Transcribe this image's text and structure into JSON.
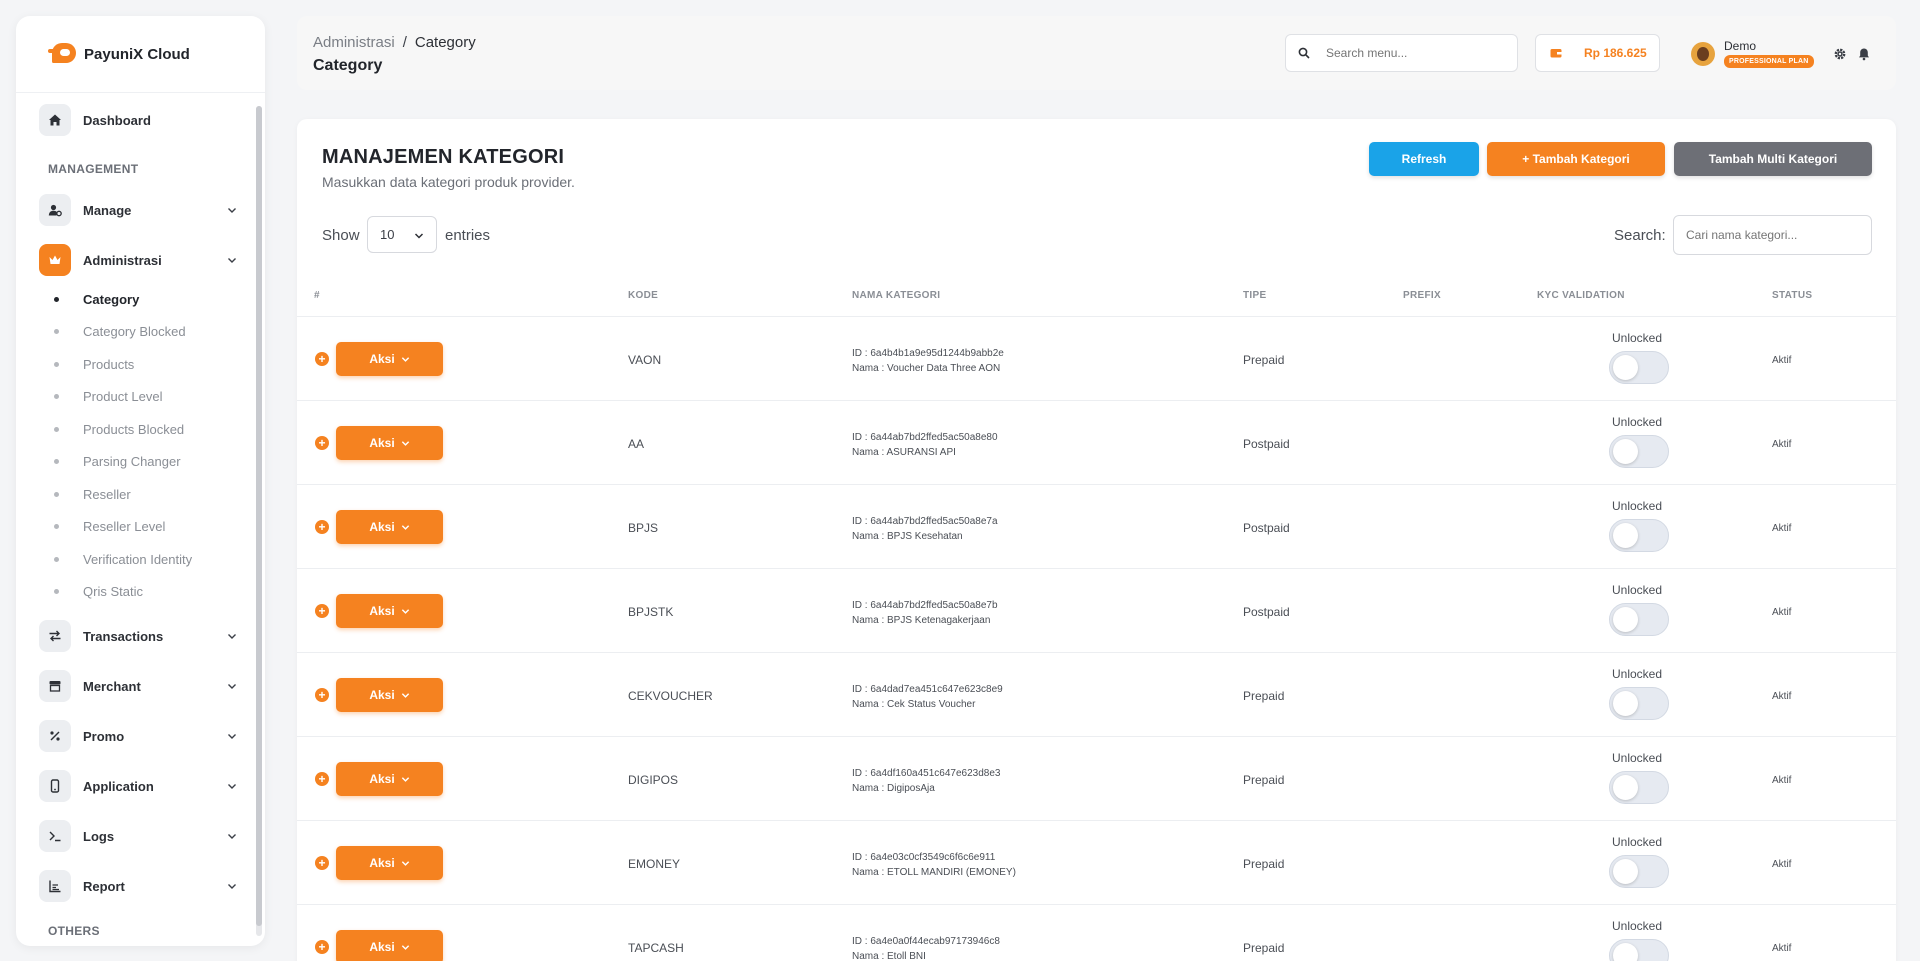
{
  "brand": {
    "name": "PayuniX Cloud"
  },
  "sidebar": {
    "dashboard_label": "Dashboard",
    "management_label": "MANAGEMENT",
    "manage_label": "Manage",
    "administrasi_label": "Administrasi",
    "sub_items": [
      "Category",
      "Category Blocked",
      "Products",
      "Product Level",
      "Products Blocked",
      "Parsing Changer",
      "Reseller",
      "Reseller Level",
      "Verification Identity",
      "Qris Static"
    ],
    "transactions_label": "Transactions",
    "merchant_label": "Merchant",
    "promo_label": "Promo",
    "application_label": "Application",
    "logs_label": "Logs",
    "report_label": "Report",
    "others_label": "OTHERS"
  },
  "header": {
    "breadcrumb_parent": "Administrasi",
    "breadcrumb_sep": "/",
    "breadcrumb_current": "Category",
    "page_title": "Category",
    "search_placeholder": "Search menu...",
    "balance": "Rp 186.625",
    "user_name": "Demo",
    "plan": "PROFESSIONAL PLAN"
  },
  "card": {
    "title": "MANAJEMEN KATEGORI",
    "subtitle": "Masukkan data kategori produk provider.",
    "refresh_label": "Refresh",
    "add_label": "+  Tambah Kategori",
    "multi_label": "Tambah Multi Kategori",
    "show_label": "Show",
    "show_value": "10",
    "entries_label": "entries",
    "search_label": "Search:",
    "search_placeholder": "Cari nama kategori..."
  },
  "table": {
    "headers": [
      "#",
      "KODE",
      "NAMA KATEGORI",
      "TIPE",
      "PREFIX",
      "KYC VALIDATION",
      "STATUS"
    ],
    "action_label": "Aksi",
    "plus_glyph": "+",
    "rows": [
      {
        "kode": "VAON",
        "id": "ID : 6a4b4b1a9e95d1244b9abb2e",
        "nama": "Nama : Voucher Data Three AON",
        "tipe": "Prepaid",
        "kyc": "Unlocked",
        "kyc_on": false,
        "status": "Aktif"
      },
      {
        "kode": "AA",
        "id": "ID : 6a44ab7bd2ffed5ac50a8e80",
        "nama": "Nama : ASURANSI API",
        "tipe": "Postpaid",
        "kyc": "Unlocked",
        "kyc_on": false,
        "status": "Aktif"
      },
      {
        "kode": "BPJS",
        "id": "ID : 6a44ab7bd2ffed5ac50a8e7a",
        "nama": "Nama : BPJS Kesehatan",
        "tipe": "Postpaid",
        "kyc": "Unlocked",
        "kyc_on": false,
        "status": "Aktif"
      },
      {
        "kode": "BPJSTK",
        "id": "ID : 6a44ab7bd2ffed5ac50a8e7b",
        "nama": "Nama : BPJS Ketenagakerjaan",
        "tipe": "Postpaid",
        "kyc": "Unlocked",
        "kyc_on": false,
        "status": "Aktif"
      },
      {
        "kode": "CEKVOUCHER",
        "id": "ID : 6a4dad7ea451c647e623c8e9",
        "nama": "Nama : Cek Status Voucher",
        "tipe": "Prepaid",
        "kyc": "Unlocked",
        "kyc_on": false,
        "status": "Aktif"
      },
      {
        "kode": "DIGIPOS",
        "id": "ID : 6a4df160a451c647e623d8e3",
        "nama": "Nama : DigiposAja",
        "tipe": "Prepaid",
        "kyc": "Unlocked",
        "kyc_on": false,
        "status": "Aktif"
      },
      {
        "kode": "EMONEY",
        "id": "ID : 6a4e03c0cf3549c6f6c6e911",
        "nama": "Nama : ETOLL MANDIRI (EMONEY)",
        "tipe": "Prepaid",
        "kyc": "Unlocked",
        "kyc_on": false,
        "status": "Aktif"
      },
      {
        "kode": "TAPCASH",
        "id": "ID : 6a4e0a0f44ecab97173946c8",
        "nama": "Nama : Etoll BNI",
        "tipe": "Prepaid",
        "kyc": "Unlocked",
        "kyc_on": false,
        "status": "Aktif"
      }
    ]
  },
  "colors": {
    "accent": "#f58220",
    "refresh": "#1aa3e8",
    "multi": "#6d6f76"
  }
}
